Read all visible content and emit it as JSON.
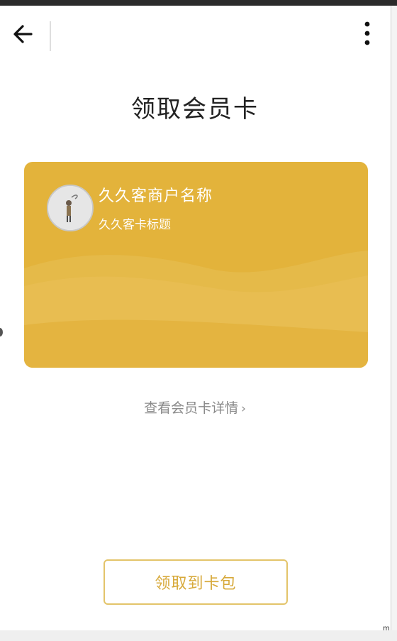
{
  "header": {
    "back_icon": "arrow-left-icon",
    "more_icon": "more-vertical-icon"
  },
  "page": {
    "title": "领取会员卡"
  },
  "card": {
    "color": "#e3b33b",
    "merchant_name": "久久客商户名称",
    "card_title": "久久客卡标题",
    "avatar_icon": "merchant-avatar-icon"
  },
  "detail_link": {
    "label": "查看会员卡详情",
    "arrow": "›"
  },
  "claim_button": {
    "label": "领取到卡包",
    "color": "#d7a93a"
  },
  "corner_mark": "m"
}
